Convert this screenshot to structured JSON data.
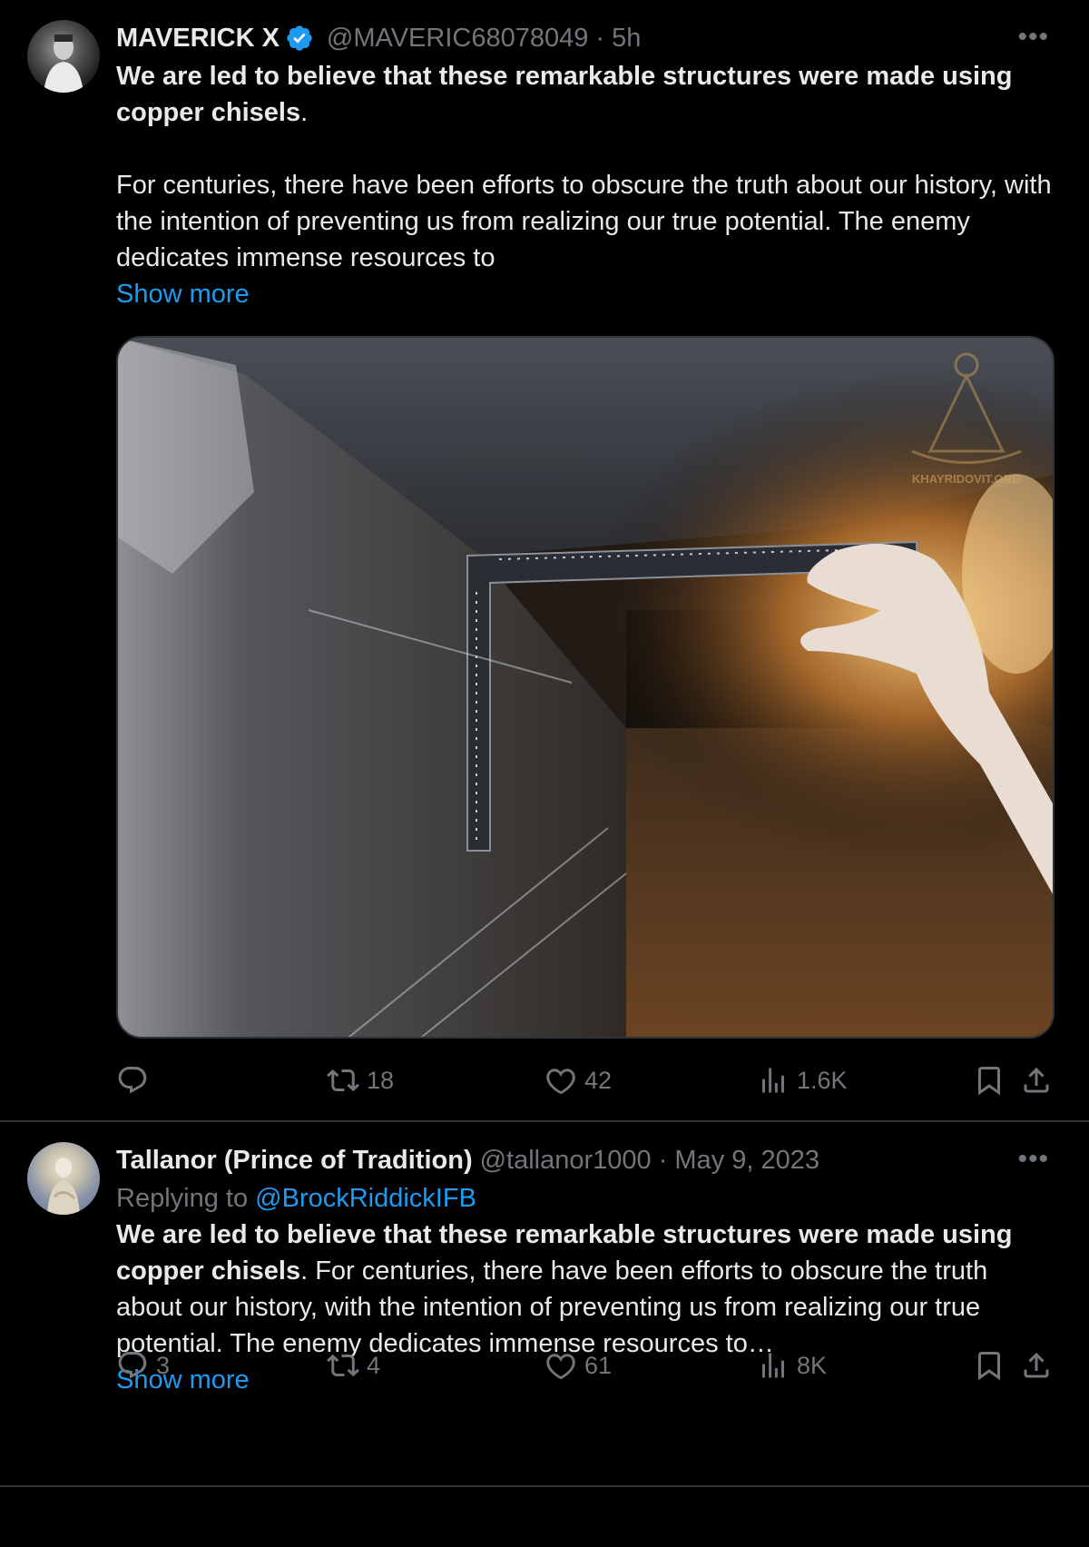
{
  "tweets": [
    {
      "display_name": "MAVERICK X",
      "handle": "@MAVERIC68078049",
      "time": "· 5h",
      "text_bold": "We are led to believe that these remarkable structures were made using copper chisels",
      "text_bold_tail": ".",
      "text_para": "For centuries, there have been efforts to obscure the truth about our history, with the intention of preventing us from realizing our true potential. The enemy dedicates immense resources to",
      "show_more": "Show more",
      "media_watermark": "KHAYRIDOVIT.ORG",
      "metrics": {
        "replies": "",
        "reposts": "18",
        "likes": "42",
        "views": "1.6K"
      }
    },
    {
      "display_name": "Tallanor (Prince of Tradition)",
      "handle": "@tallanor1000",
      "time": "· May 9, 2023",
      "replying_to_label": "Replying to",
      "replying_to_handle": "@BrockRiddickIFB",
      "text_bold": "We are led to believe that these remarkable structures were made using copper chisels",
      "text_rest": ". For centuries, there have been efforts to obscure the truth about our history, with the intention of preventing us from realizing our true potential. The enemy dedicates immense resources to…",
      "show_more": "Show more",
      "metrics": {
        "replies": "3",
        "reposts": "4",
        "likes": "61",
        "views": "8K"
      }
    }
  ],
  "colors": {
    "background": "#000000",
    "text": "#e7e9ea",
    "muted": "#71767b",
    "link": "#1d9bf0",
    "divider": "#2f3336"
  },
  "icons": [
    "verified-badge-icon",
    "more-dots-icon",
    "reply-icon",
    "repost-icon",
    "like-icon",
    "views-icon",
    "bookmark-icon",
    "share-icon"
  ]
}
